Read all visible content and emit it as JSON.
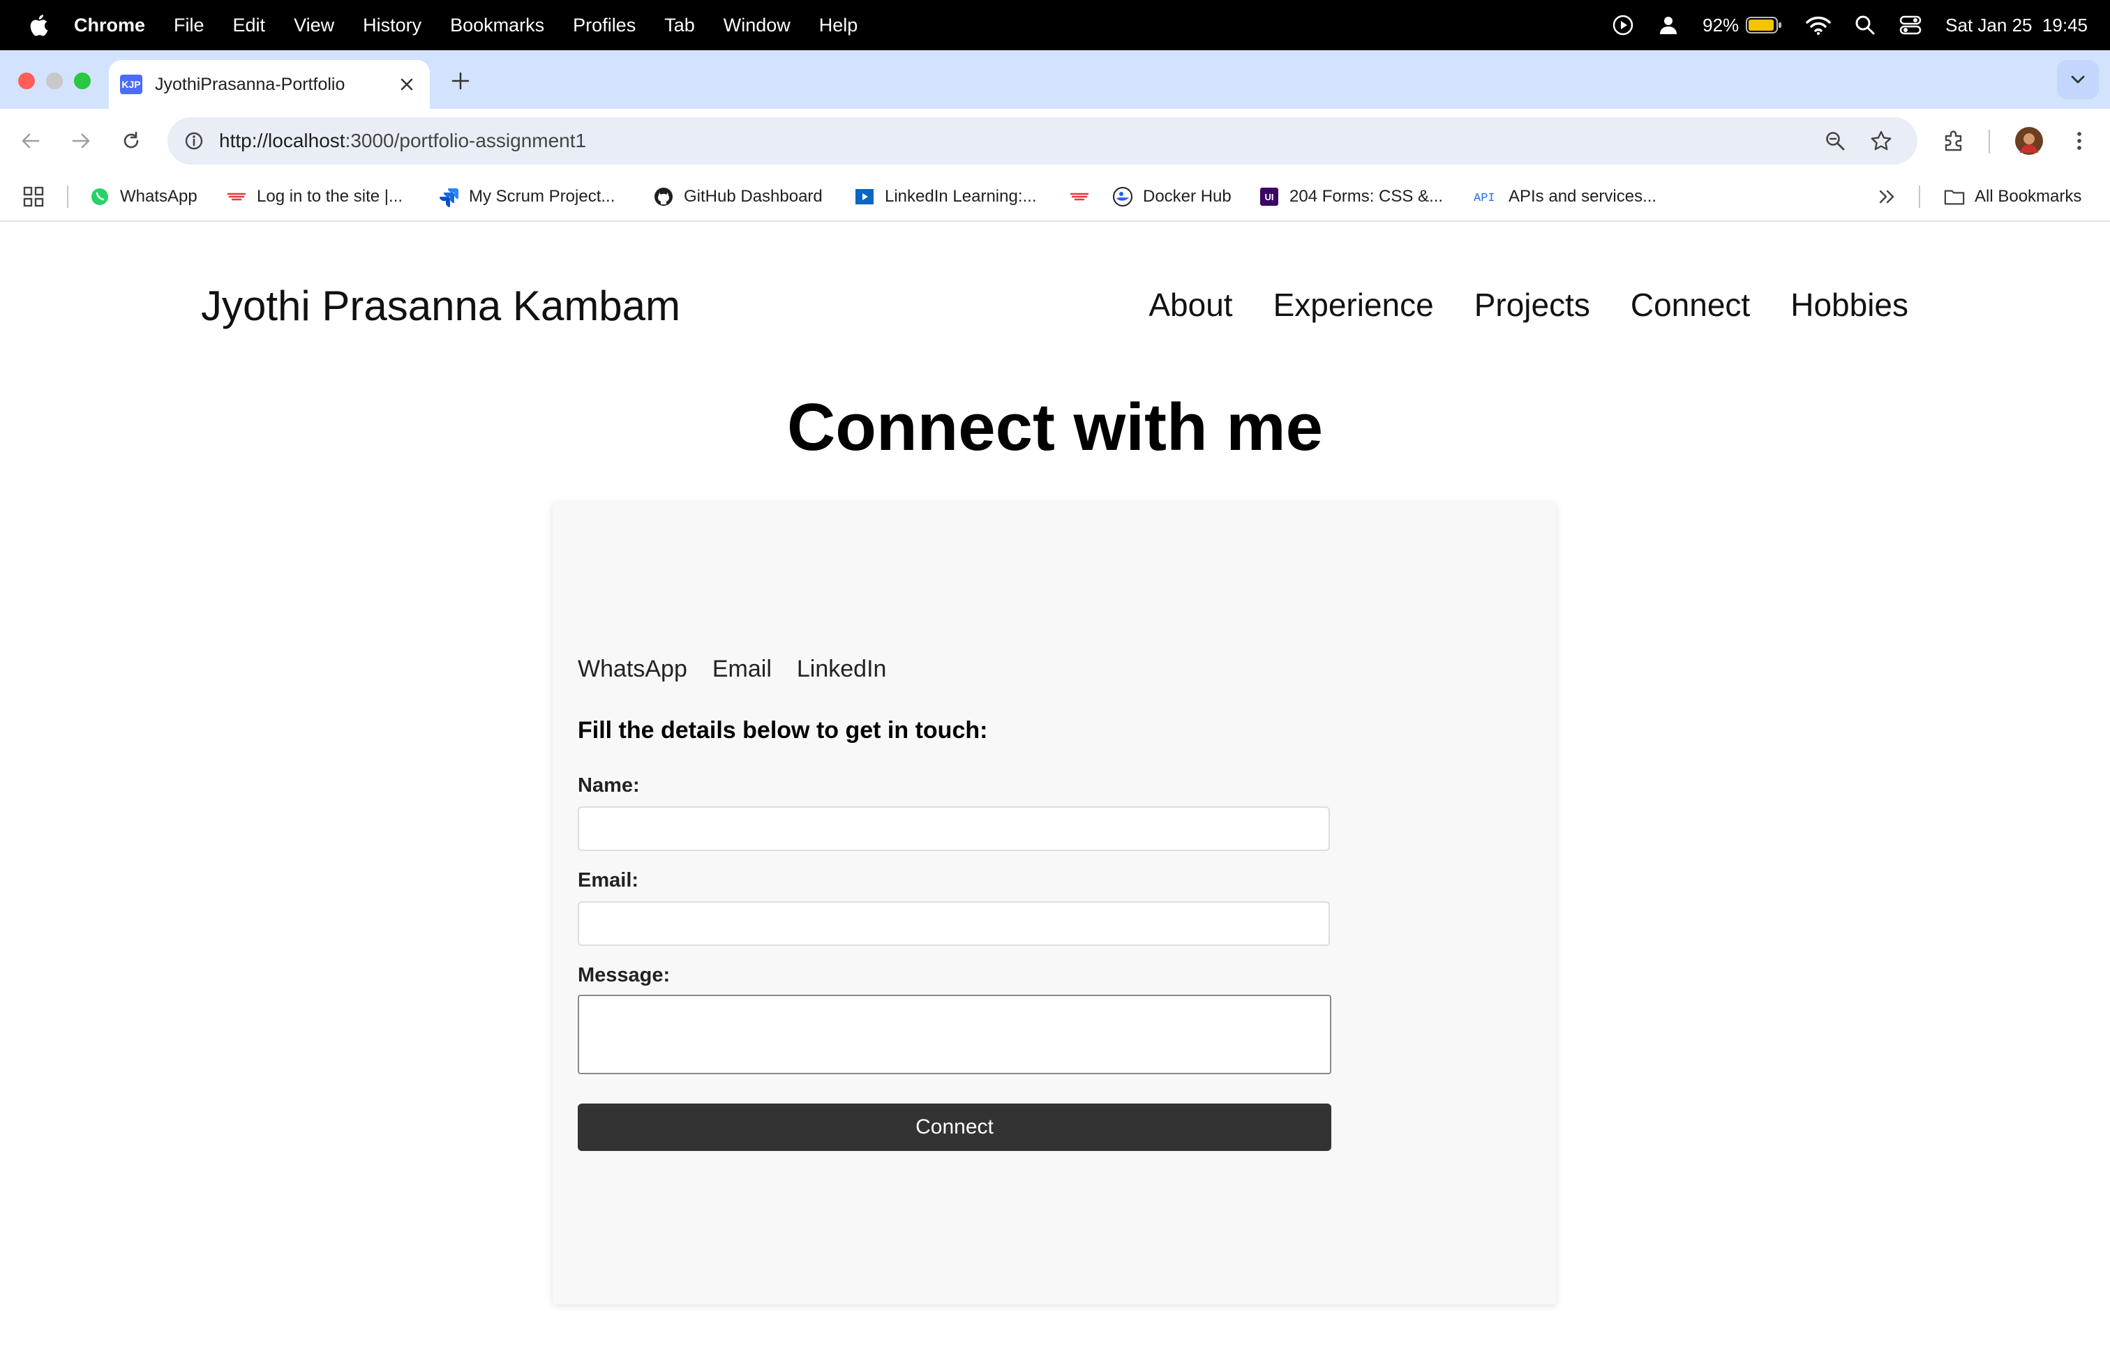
{
  "menubar": {
    "app_name": "Chrome",
    "items": [
      "File",
      "Edit",
      "View",
      "History",
      "Bookmarks",
      "Profiles",
      "Tab",
      "Window",
      "Help"
    ],
    "battery_percent": "92%",
    "datetime": "Sat Jan 25  19:45"
  },
  "browser": {
    "tab_title": "JyothiPrasanna-Portfolio",
    "favicon_text": "KJP",
    "url_host": "http://localhost",
    "url_path": ":3000/portfolio-assignment1"
  },
  "bookmarks": {
    "items": [
      {
        "label": "WhatsApp",
        "icon": "whatsapp-icon",
        "color": "#25d366"
      },
      {
        "label": "Log in to the site |...",
        "icon": "site-logo-icon",
        "color": "#e53935"
      },
      {
        "label": "My Scrum Project...",
        "icon": "jira-icon",
        "color": "#2684ff"
      },
      {
        "label": "GitHub Dashboard",
        "icon": "github-icon",
        "color": "#1f1f1f"
      },
      {
        "label": "LinkedIn Learning:...",
        "icon": "linkedin-learning-icon",
        "color": "#0a66c2"
      },
      {
        "label": "",
        "icon": "site-logo-icon",
        "color": "#e53935"
      },
      {
        "label": "Docker Hub",
        "icon": "docker-icon",
        "color": "#1d63ed"
      },
      {
        "label": "204 Forms: CSS &...",
        "icon": "ui-icon",
        "color": "#3b0764"
      },
      {
        "label": "APIs and services...",
        "icon": "api-icon",
        "color": "#1a73e8"
      }
    ],
    "all_bookmarks_label": "All Bookmarks"
  },
  "site": {
    "brand": "Jyothi Prasanna Kambam",
    "nav": [
      "About",
      "Experience",
      "Projects",
      "Connect",
      "Hobbies"
    ],
    "heading": "Connect with me",
    "social_links": [
      "WhatsApp",
      "Email",
      "LinkedIn"
    ],
    "form": {
      "title": "Fill the details below to get in touch:",
      "name_label": "Name:",
      "name_value": "",
      "email_label": "Email:",
      "email_value": "",
      "message_label": "Message:",
      "message_value": "",
      "submit_label": "Connect"
    }
  }
}
